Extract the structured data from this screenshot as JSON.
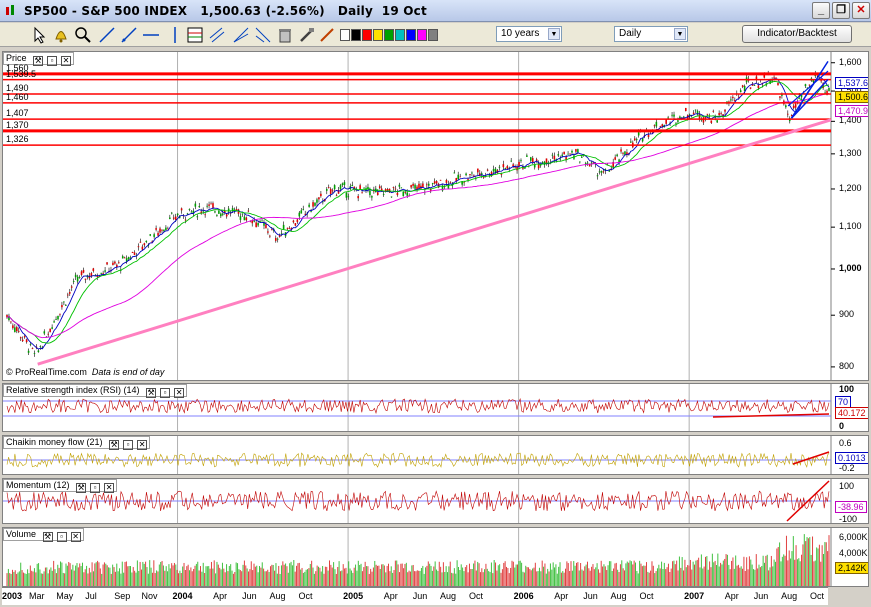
{
  "window": {
    "title": "SP500 - S&P 500 INDEX",
    "quote": "1,500.63 (-2.56%)",
    "period": "Daily",
    "date": "19 Oct",
    "minimize": "_",
    "restore": "❐",
    "close": "✕"
  },
  "toolbar": {
    "range_value": "10 years",
    "interval_value": "Daily",
    "indicator_button": "Indicator/Backtest",
    "swatch_colors": [
      "#ffffff",
      "#000000",
      "#ff0000",
      "#ffe000",
      "#00a000",
      "#00c0c0",
      "#0000ff",
      "#ff00ff",
      "#808080"
    ]
  },
  "price_panel": {
    "label": "Price",
    "watermark": "© ProRealTime.com",
    "note": "Data is end of day",
    "y_ticks": [
      "1,600",
      "1,500",
      "1,400",
      "1,300",
      "1,200",
      "1,100",
      "1,000",
      "900",
      "800"
    ],
    "levels": [
      "1,560",
      "1,539.5",
      "1,490",
      "1,460",
      "1,407",
      "1,370",
      "1,326"
    ],
    "tag_last": "1,500.63",
    "tag_blue": "1,537.6",
    "tag_pink": "1,470.9"
  },
  "rsi_panel": {
    "label": "Relative strength index (RSI) (14)",
    "y_ticks": [
      "100",
      "70",
      "0"
    ],
    "tag_value": "40.172",
    "tag_70": "70"
  },
  "cmf_panel": {
    "label": "Chaikin money flow (21)",
    "y_ticks": [
      "0.6",
      "-0.2"
    ],
    "tag_value": "0.1013"
  },
  "momentum_panel": {
    "label": "Momentum (12)",
    "y_ticks": [
      "100",
      "-100"
    ],
    "tag_value": "-38.96"
  },
  "volume_panel": {
    "label": "Volume",
    "y_ticks": [
      "6,000K",
      "4,000K"
    ],
    "tag_value": "2,142K"
  },
  "x_axis": [
    {
      "label": "2003",
      "bold": true
    },
    {
      "label": "Mar"
    },
    {
      "label": "May"
    },
    {
      "label": "Jul"
    },
    {
      "label": "Sep"
    },
    {
      "label": "Nov"
    },
    {
      "label": "2004",
      "bold": true
    },
    {
      "label": "Apr"
    },
    {
      "label": "Jun"
    },
    {
      "label": "Aug"
    },
    {
      "label": "Oct"
    },
    {
      "label": "2005",
      "bold": true
    },
    {
      "label": "Apr"
    },
    {
      "label": "Jun"
    },
    {
      "label": "Aug"
    },
    {
      "label": "Oct"
    },
    {
      "label": "2006",
      "bold": true
    },
    {
      "label": "Apr"
    },
    {
      "label": "Jun"
    },
    {
      "label": "Aug"
    },
    {
      "label": "Oct"
    },
    {
      "label": "2007",
      "bold": true
    },
    {
      "label": "Apr"
    },
    {
      "label": "Jun"
    },
    {
      "label": "Aug"
    },
    {
      "label": "Oct"
    }
  ],
  "chart_data": {
    "type": "line",
    "x": [
      "2003-01",
      "2003-03",
      "2003-06",
      "2003-09",
      "2004-01",
      "2004-03",
      "2004-06",
      "2004-08",
      "2004-12",
      "2005-03",
      "2005-06",
      "2005-09",
      "2006-01",
      "2006-05",
      "2006-07",
      "2006-10",
      "2007-01",
      "2007-03",
      "2007-05",
      "2007-07",
      "2007-08",
      "2007-10",
      "2007-10-19"
    ],
    "series": [
      {
        "values": [
          900,
          820,
          980,
          1010,
          1130,
          1150,
          1130,
          1075,
          1200,
          1190,
          1200,
          1230,
          1270,
          1300,
          1240,
          1370,
          1430,
          1410,
          1520,
          1550,
          1410,
          1560,
          1500
        ]
      }
    ],
    "ylim": [
      780,
      1610
    ],
    "y_scale": "log"
  }
}
